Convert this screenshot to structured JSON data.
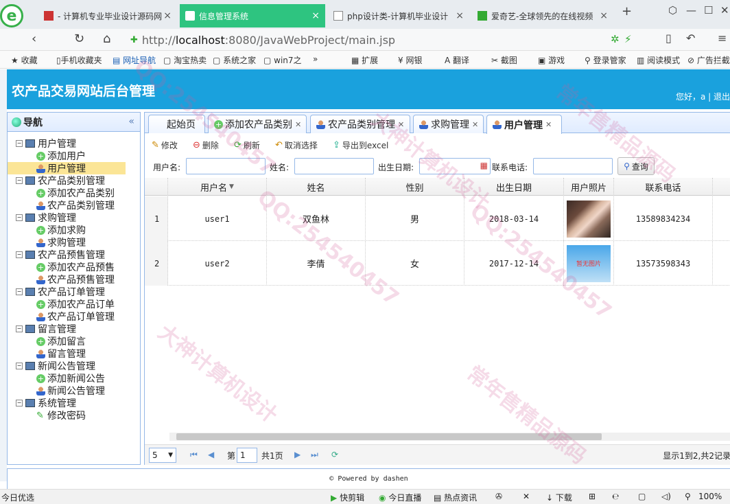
{
  "browser": {
    "tabs": [
      {
        "label": "- 计算机专业毕业设计源码网"
      },
      {
        "label": "信息管理系统"
      },
      {
        "label": "php设计类-计算机毕业设计"
      },
      {
        "label": "爱奇艺-全球领先的在线视频"
      }
    ],
    "tab_close": "×",
    "new_tab": "+",
    "url_host": "http://",
    "url_main": "localhost",
    "url_rest": ":8080/JavaWebProject/main.jsp",
    "bookmarks": [
      "收藏",
      "手机收藏夹",
      "网址导航",
      "淘宝热卖",
      "系统之家",
      "win7之",
      "扩展",
      "网银",
      "翻译",
      "截图",
      "游戏",
      "登录管家",
      "阅读模式",
      "广告拦截"
    ],
    "more": "»"
  },
  "banner": {
    "title": "农产品交易网站后台管理",
    "greeting": "您好，a | 退出"
  },
  "nav": {
    "title": "导航",
    "collapse": "«",
    "groups": [
      {
        "label": "用户管理",
        "items": [
          {
            "label": "添加用户",
            "type": "add"
          },
          {
            "label": "用户管理",
            "type": "user"
          }
        ]
      },
      {
        "label": "农产品类别管理",
        "items": [
          {
            "label": "添加农产品类别",
            "type": "add"
          },
          {
            "label": "农产品类别管理",
            "type": "user"
          }
        ]
      },
      {
        "label": "求购管理",
        "items": [
          {
            "label": "添加求购",
            "type": "add"
          },
          {
            "label": "求购管理",
            "type": "user"
          }
        ]
      },
      {
        "label": "农产品预售管理",
        "items": [
          {
            "label": "添加农产品预售",
            "type": "add"
          },
          {
            "label": "农产品预售管理",
            "type": "user"
          }
        ]
      },
      {
        "label": "农产品订单管理",
        "items": [
          {
            "label": "添加农产品订单",
            "type": "add"
          },
          {
            "label": "农产品订单管理",
            "type": "user"
          }
        ]
      },
      {
        "label": "留言管理",
        "items": [
          {
            "label": "添加留言",
            "type": "add"
          },
          {
            "label": "留言管理",
            "type": "user"
          }
        ]
      },
      {
        "label": "新闻公告管理",
        "items": [
          {
            "label": "添加新闻公告",
            "type": "add"
          },
          {
            "label": "新闻公告管理",
            "type": "user"
          }
        ]
      },
      {
        "label": "系统管理",
        "items": [
          {
            "label": "修改密码",
            "type": "pen"
          }
        ]
      }
    ]
  },
  "panel_tabs": [
    {
      "label": "起始页"
    },
    {
      "label": "添加农产品类别"
    },
    {
      "label": "农产品类别管理"
    },
    {
      "label": "求购管理"
    },
    {
      "label": "用户管理"
    }
  ],
  "toolbar": {
    "edit": "修改",
    "delete": "删除",
    "refresh": "刷新",
    "cancel": "取消选择",
    "export": "导出到excel"
  },
  "search": {
    "username": "用户名:",
    "name": "姓名:",
    "birthday": "出生日期:",
    "phone": "联系电话:",
    "query": "查询"
  },
  "table": {
    "columns": [
      "用户名",
      "姓名",
      "性别",
      "出生日期",
      "用户照片",
      "联系电话"
    ],
    "sort_indicator": "▼",
    "rows": [
      {
        "num": "1",
        "username": "user1",
        "name": "双鱼林",
        "sex": "男",
        "birthday": "2018-03-14",
        "photo": "",
        "phone": "13589834234"
      },
      {
        "num": "2",
        "username": "user2",
        "name": "李倩",
        "sex": "女",
        "birthday": "2017-12-14",
        "photo": "暂无图片",
        "phone": "13573598343"
      }
    ]
  },
  "pager": {
    "page_size": "5",
    "page_label": "第",
    "page_value": "1",
    "total_pages": "共1页",
    "summary": "显示1到2,共2记录"
  },
  "footer": "© Powered by dashen",
  "status": {
    "left": "今日优选",
    "items": [
      "快剪辑",
      "今日直播",
      "热点资讯",
      "下载",
      "100%"
    ]
  },
  "watermarks": [
    "大神计算机设计",
    "QQ:254540457",
    "常年售精品源码"
  ]
}
